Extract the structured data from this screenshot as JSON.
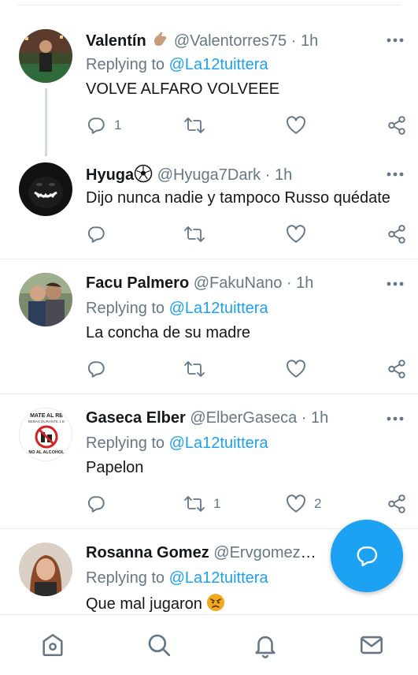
{
  "tweets": [
    {
      "name": "Valentín",
      "name_emoji": "call-me-hand",
      "handle": "@Valentorres75",
      "time": "1h",
      "replying_prefix": "Replying to ",
      "replying_to": "@La12tuittera",
      "text": "VOLVE ALFARO VOLVEEE",
      "replies": "1",
      "retweets": "",
      "likes": ""
    },
    {
      "name": "Hyuga",
      "name_emoji": "soccer-ball",
      "handle": "@Hyuga7Dark",
      "time": "1h",
      "text": "Dijo nunca nadie y tampoco Russo quédate",
      "replies": "",
      "retweets": "",
      "likes": ""
    },
    {
      "name": "Facu Palmero",
      "handle": "@FakuNano",
      "time": "1h",
      "replying_prefix": "Replying to ",
      "replying_to": "@La12tuittera",
      "text": "La concha de su madre",
      "replies": "",
      "retweets": "",
      "likes": ""
    },
    {
      "name": "Gaseca Elber",
      "handle": "@ElberGaseca",
      "time": "1h",
      "replying_prefix": "Replying to ",
      "replying_to": "@La12tuittera",
      "text": "Papelon",
      "replies": "",
      "retweets": "1",
      "likes": "2",
      "avatar_text_top": "MATE AL RE",
      "avatar_text_mid": "BEBAS DURANTE 1 D",
      "avatar_text_bottom": "NO AL ALCOHOL"
    },
    {
      "name": "Rosanna Gomez",
      "handle": "@ErvgomezRo...",
      "time": "",
      "replying_prefix": "Replying to ",
      "replying_to": "@La12tuittera",
      "text": "Que mal jugaron",
      "text_emoji": "angry-face"
    }
  ],
  "separator": "·",
  "colors": {
    "accent": "#1da1f2",
    "text": "#14171a",
    "muted": "#657786",
    "divider": "#e6ecf0"
  },
  "bottom_nav": [
    "home-icon",
    "search-icon",
    "notifications-icon",
    "messages-icon"
  ],
  "fab_icon": "compose-reply-icon"
}
